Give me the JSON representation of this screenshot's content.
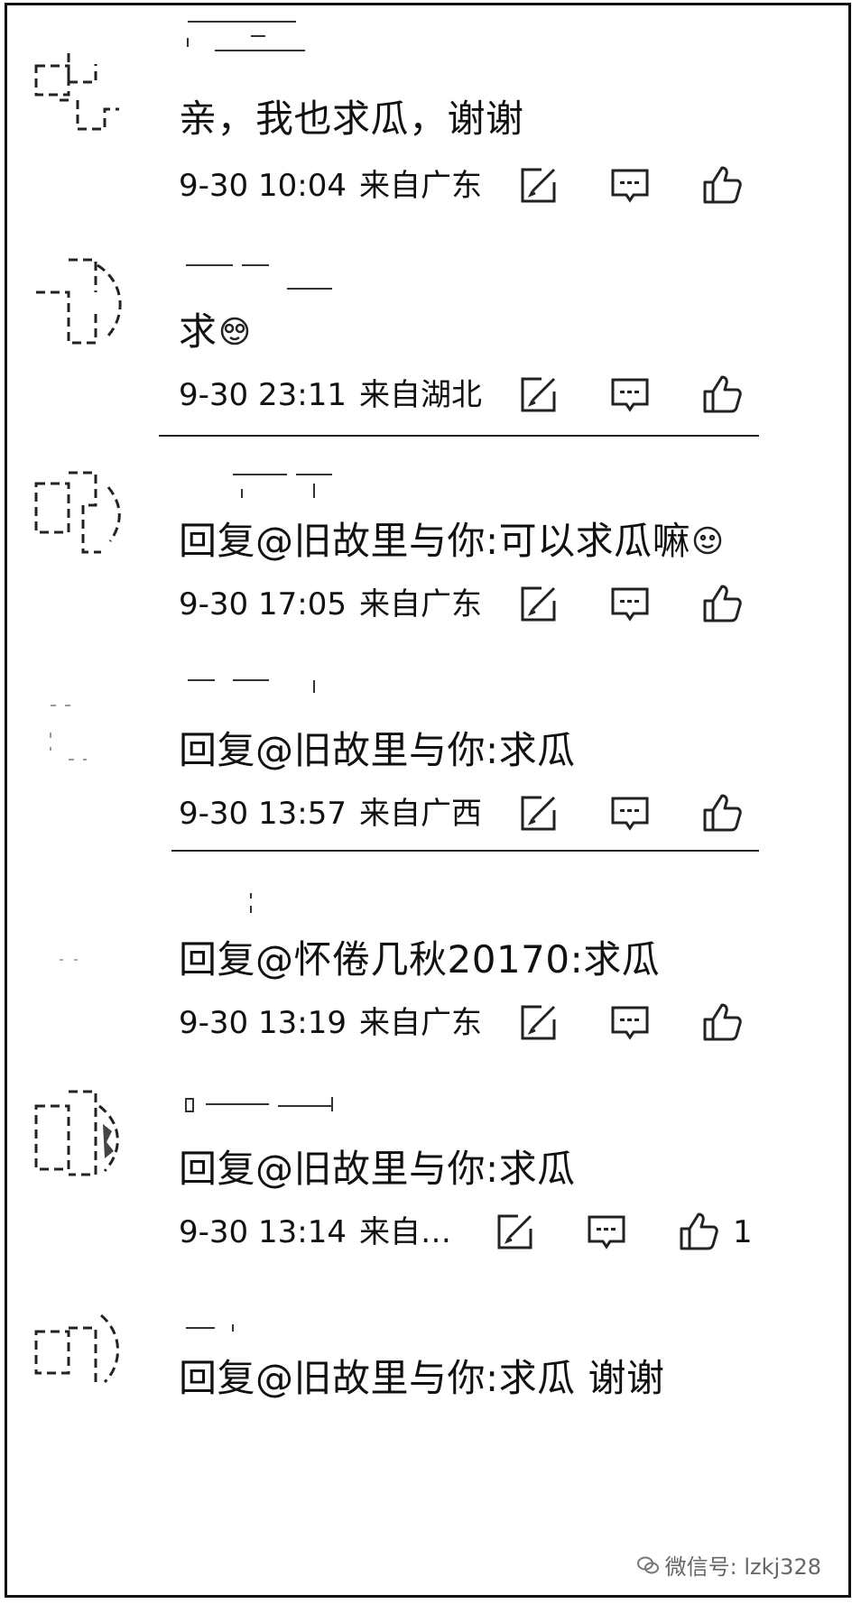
{
  "comments": [
    {
      "text": "亲，我也求瓜，谢谢",
      "time": "9-30 10:04",
      "location": "来自广东",
      "likes": ""
    },
    {
      "text": "求",
      "time": "9-30 23:11",
      "location": "来自湖北",
      "likes": ""
    },
    {
      "text": "回复@旧故里与你:可以求瓜嘛",
      "time": "9-30 17:05",
      "location": "来自广东",
      "likes": ""
    },
    {
      "text": "回复@旧故里与你:求瓜",
      "time": "9-30 13:57",
      "location": "来自广西",
      "likes": ""
    },
    {
      "text": "回复@怀倦几秋20170:求瓜",
      "time": "9-30 13:19",
      "location": "来自广东",
      "likes": ""
    },
    {
      "text": "回复@旧故里与你:求瓜",
      "time": "9-30 13:14",
      "location": "来自…",
      "likes": "1"
    },
    {
      "text": "回复@旧故里与你:求瓜  谢谢",
      "time": "",
      "location": "",
      "likes": ""
    }
  ],
  "watermark": "微信号: lzkj328",
  "icons": {
    "edit": "edit-icon",
    "reply": "comment-icon",
    "like": "thumbs-up-icon"
  }
}
